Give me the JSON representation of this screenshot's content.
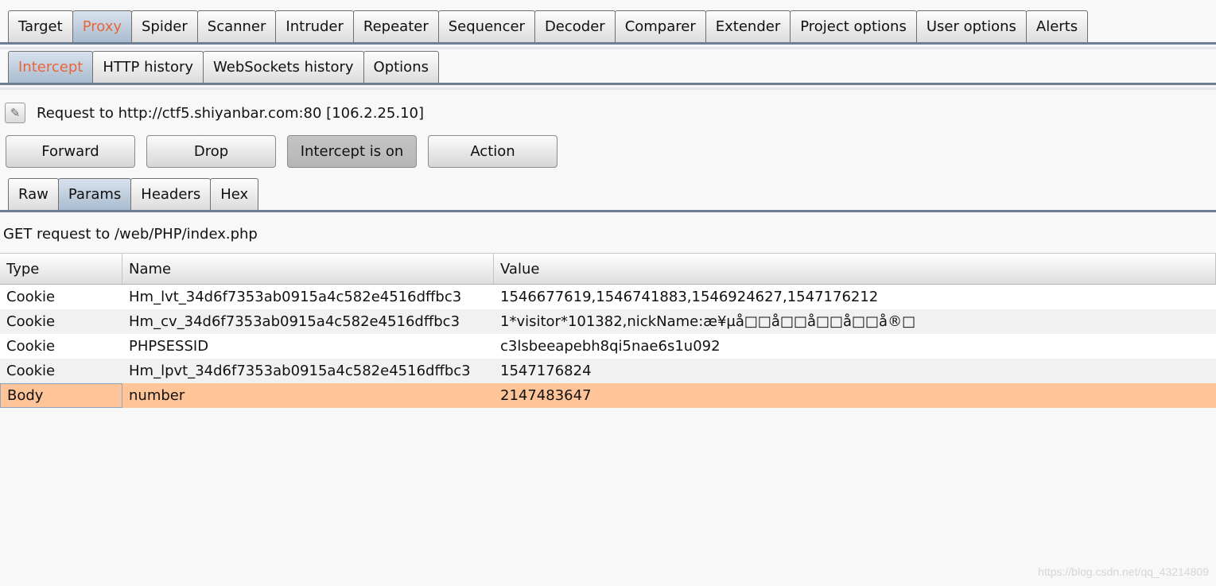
{
  "main_tabs": [
    "Target",
    "Proxy",
    "Spider",
    "Scanner",
    "Intruder",
    "Repeater",
    "Sequencer",
    "Decoder",
    "Comparer",
    "Extender",
    "Project options",
    "User options",
    "Alerts"
  ],
  "main_active": "Proxy",
  "proxy_tabs": [
    "Intercept",
    "HTTP history",
    "WebSockets history",
    "Options"
  ],
  "proxy_active": "Intercept",
  "request_line": "Request to http://ctf5.shiyanbar.com:80  [106.2.25.10]",
  "buttons": {
    "forward": "Forward",
    "drop": "Drop",
    "intercept": "Intercept is on",
    "action": "Action"
  },
  "message_tabs": [
    "Raw",
    "Params",
    "Headers",
    "Hex"
  ],
  "message_active": "Params",
  "request_title": "GET request to /web/PHP/index.php",
  "params_table": {
    "headers": [
      "Type",
      "Name",
      "Value"
    ],
    "rows": [
      [
        "Cookie",
        "Hm_lvt_34d6f7353ab0915a4c582e4516dffbc3",
        "1546677619,1546741883,1546924627,1547176212"
      ],
      [
        "Cookie",
        "Hm_cv_34d6f7353ab0915a4c582e4516dffbc3",
        "1*visitor*101382,nickName:æ¥µå□□å□□å□□å□□å®□"
      ],
      [
        "Cookie",
        "PHPSESSID",
        "c3lsbeeapebh8qi5nae6s1u092"
      ],
      [
        "Cookie",
        "Hm_lpvt_34d6f7353ab0915a4c582e4516dffbc3",
        "1547176824"
      ],
      [
        "Body",
        "number",
        "2147483647"
      ]
    ],
    "selected_row": 4
  },
  "watermark": "https://blog.csdn.net/qq_43214809",
  "colors": {
    "active_tab_text": "#e8653b",
    "selected_row": "#ffc598",
    "tab_active_bg": "#a9bccf"
  },
  "icons": {
    "request_edit": "pencil-icon"
  }
}
